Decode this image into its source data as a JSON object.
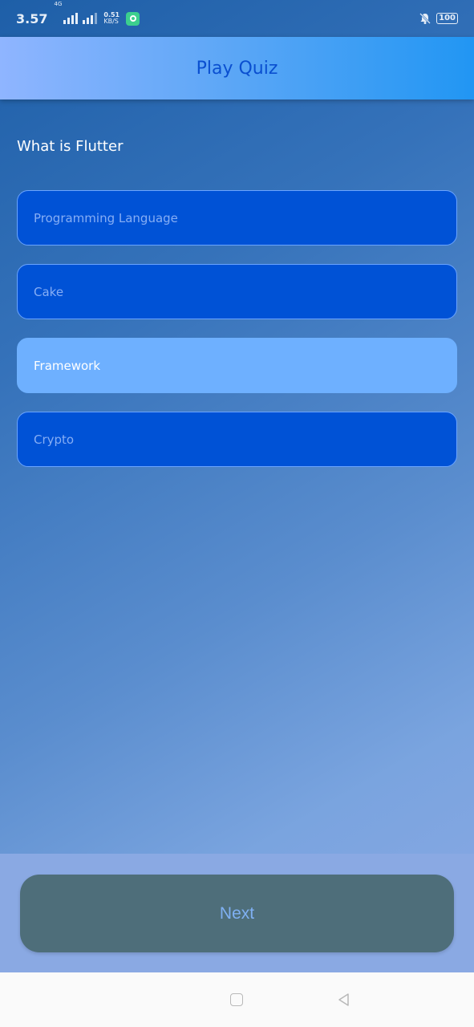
{
  "status_bar": {
    "time": "3.57",
    "network_label": "4G",
    "speed_value": "0.51",
    "speed_unit": "KB/S",
    "battery": "100"
  },
  "app_bar": {
    "title": "Play Quiz"
  },
  "quiz": {
    "question": "What is Flutter",
    "options": [
      {
        "label": "Programming Language",
        "selected": false
      },
      {
        "label": "Cake",
        "selected": false
      },
      {
        "label": "Framework",
        "selected": true
      },
      {
        "label": "Crypto",
        "selected": false
      }
    ]
  },
  "next_button": {
    "label": "Next"
  },
  "nav_bar": {
    "icons": [
      "menu-icon",
      "home-icon",
      "back-icon"
    ]
  },
  "colors": {
    "accent": "#0052d6",
    "selected": "#6eb0ff",
    "title": "#0a4fd0",
    "next_button": "#4e6e7a"
  }
}
